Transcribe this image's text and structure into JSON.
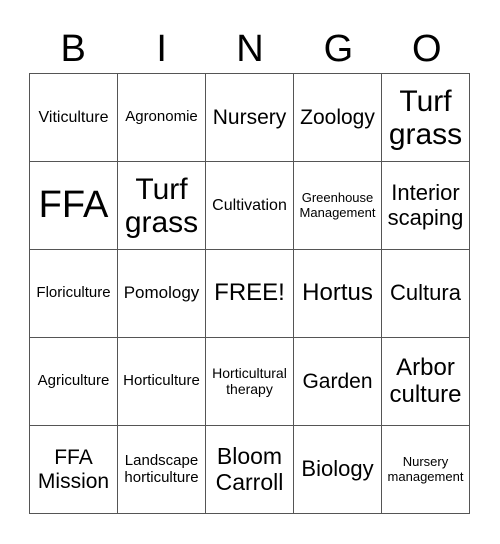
{
  "header": [
    "B",
    "I",
    "N",
    "G",
    "O"
  ],
  "grid": [
    [
      "Viticulture",
      "Agronomie",
      "Nursery",
      "Zoology",
      "Turf grass"
    ],
    [
      "FFA",
      "Turf grass",
      "Cultivation",
      "Greenhouse Management",
      "Interior scaping"
    ],
    [
      "Floriculture",
      "Pomology",
      "FREE!",
      "Hortus",
      "Cultura"
    ],
    [
      "Agriculture",
      "Horticulture",
      "Horticultural therapy",
      "Garden",
      "Arbor culture"
    ],
    [
      "FFA Mission",
      "Landscape horticulture",
      "Bloom Carroll",
      "Biology",
      "Nursery management"
    ]
  ]
}
